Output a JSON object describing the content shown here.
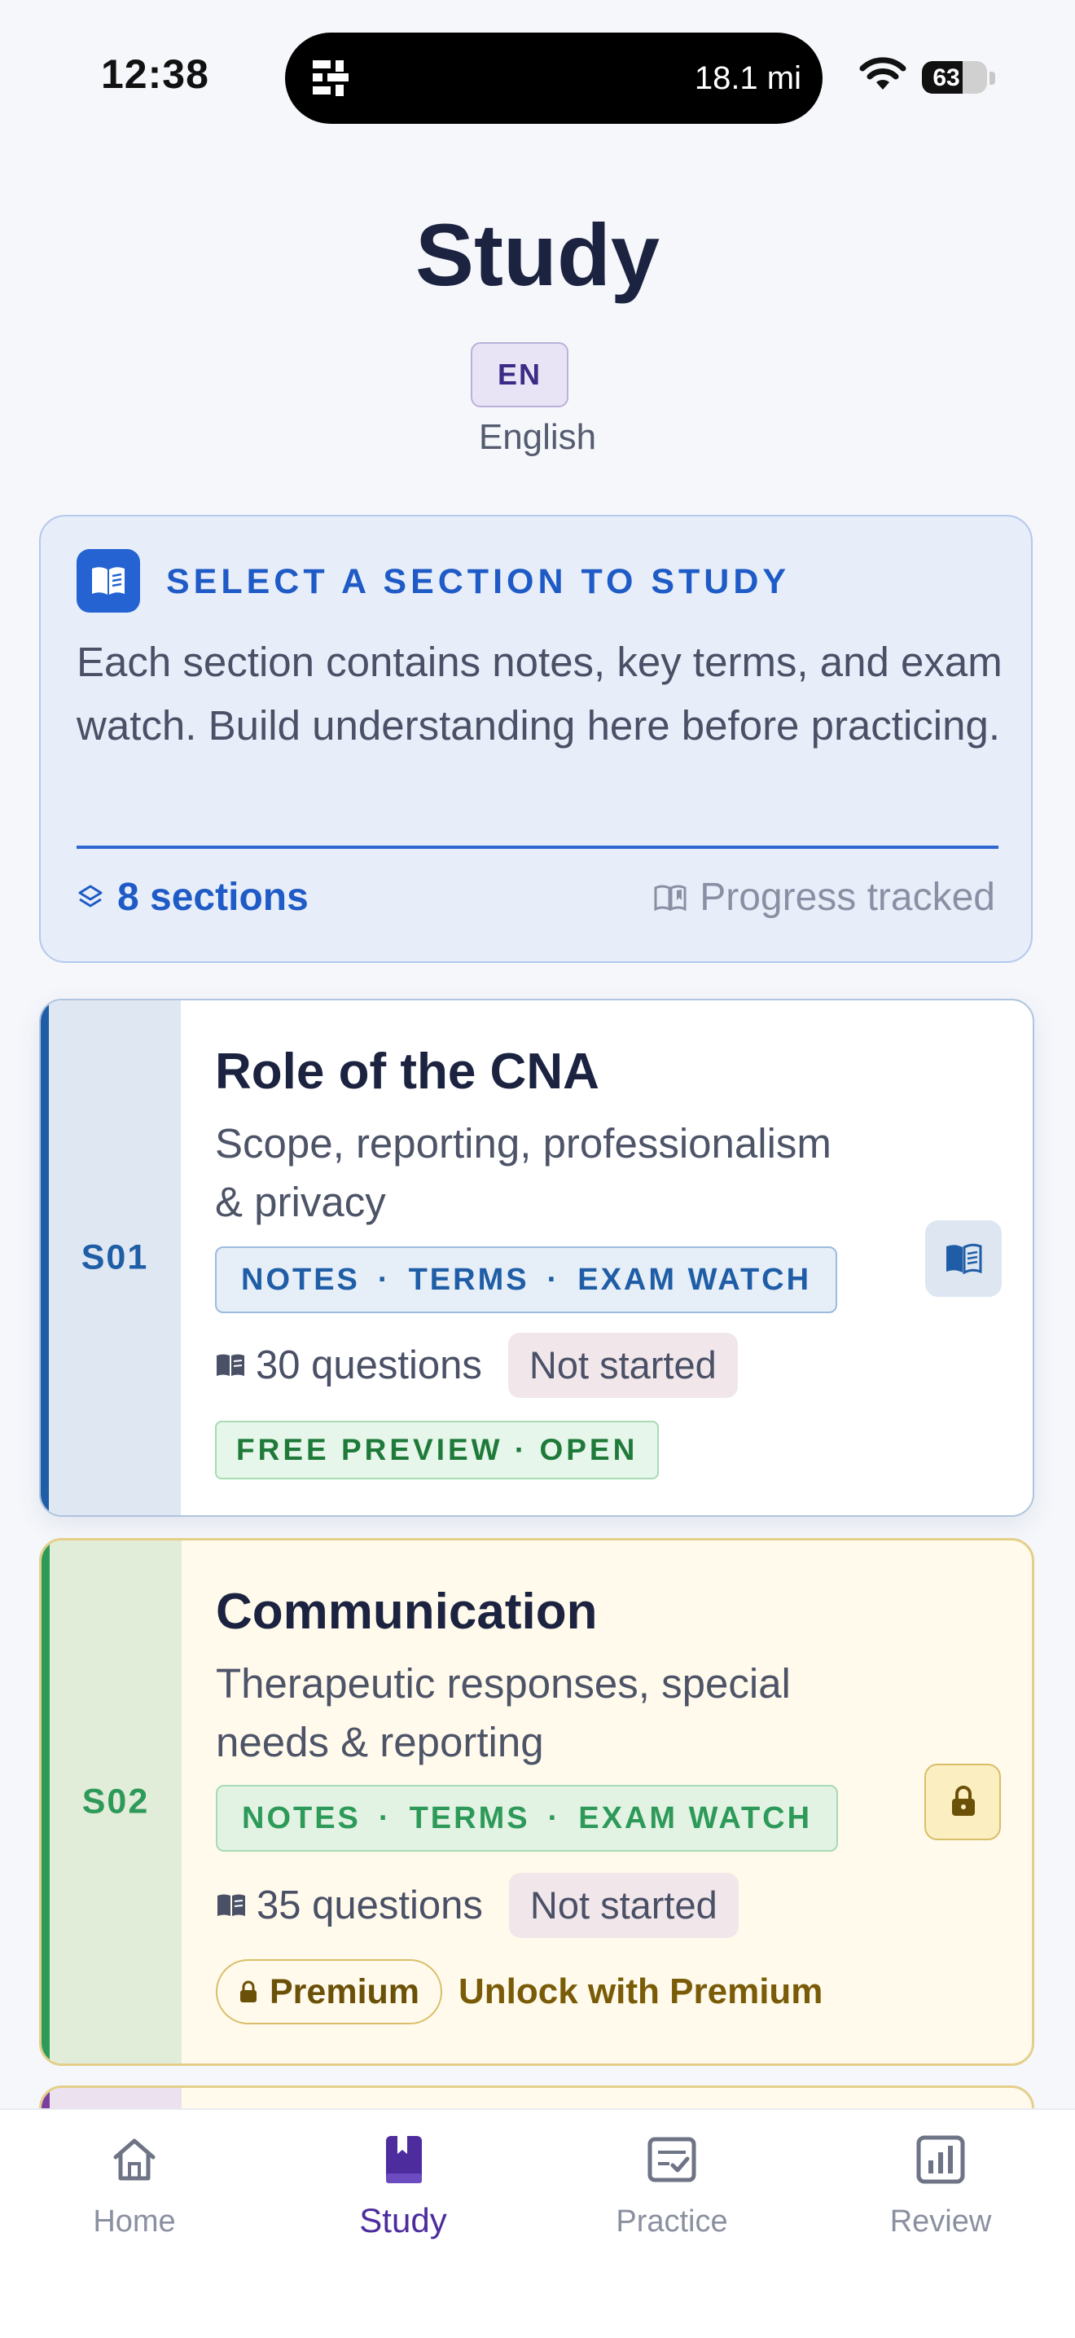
{
  "status_bar": {
    "time": "12:38",
    "island_text": "18.1 mi",
    "battery": "63",
    "battery_level": 0.63
  },
  "header": {
    "title": "Study",
    "language_code": "EN",
    "language_name": "English"
  },
  "intro": {
    "heading": "SELECT A SECTION TO STUDY",
    "description": "Each section contains notes, key terms, and exam watch. Build understanding here before practicing.",
    "sections_count": "8 sections",
    "progress_label": "Progress tracked",
    "accent": "#2463d1"
  },
  "sections": [
    {
      "code": "S01",
      "title": "Role of the CNA",
      "description": "Scope, reporting, professionalism & privacy",
      "tags": [
        "NOTES",
        "TERMS",
        "EXAM WATCH"
      ],
      "questions": "30 questions",
      "status": "Not started",
      "badge": "FREE PREVIEW · OPEN",
      "action_icon": "book-open-icon",
      "accent": "#1f5ea6"
    },
    {
      "code": "S02",
      "title": "Communication",
      "description": "Therapeutic responses, special needs & reporting",
      "tags": [
        "NOTES",
        "TERMS",
        "EXAM WATCH"
      ],
      "questions": "35 questions",
      "status": "Not started",
      "premium_label": "Premium",
      "unlock_text": "Unlock with Premium",
      "action_icon": "lock-icon",
      "accent": "#2e9a5a"
    },
    {
      "accent": "#7a3fa0"
    }
  ],
  "tab_bar": {
    "tabs": [
      {
        "label": "Home",
        "icon": "home-icon"
      },
      {
        "label": "Study",
        "icon": "book-icon",
        "active": true
      },
      {
        "label": "Practice",
        "icon": "checklist-icon"
      },
      {
        "label": "Review",
        "icon": "chart-icon"
      }
    ],
    "active_color": "#4d2d9e"
  }
}
